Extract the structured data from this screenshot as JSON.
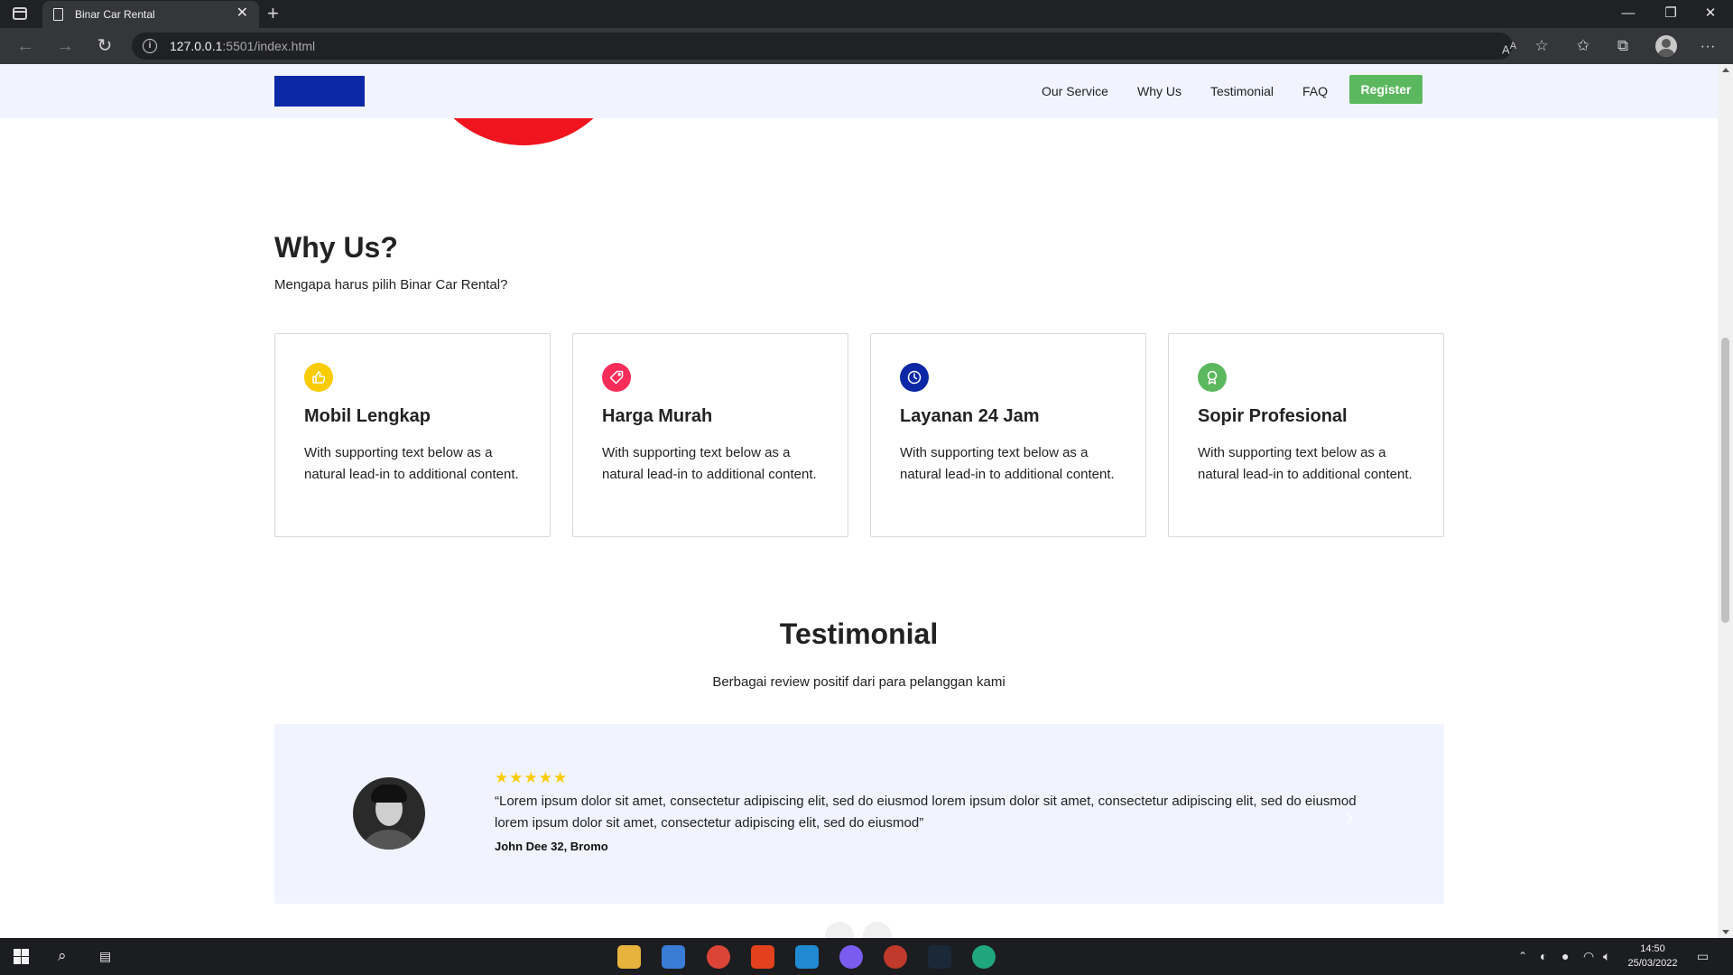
{
  "browser": {
    "tab_title": "Binar Car Rental",
    "tab_close": "✕",
    "new_tab": "+",
    "url_host": "127.0.0.1",
    "url_rest": ":5501/index.html",
    "window_minimize": "—",
    "window_restore": "❐",
    "window_close": "✕"
  },
  "navbar": {
    "links": [
      "Our Service",
      "Why Us",
      "Testimonial",
      "FAQ"
    ],
    "register_label": "Register",
    "logo_color": "#0d28a6"
  },
  "why_us": {
    "title": "Why Us?",
    "subtitle": "Mengapa harus pilih Binar Car Rental?",
    "cards": [
      {
        "title": "Mobil Lengkap",
        "text": "With supporting text below as a natural lead-in to additional content.",
        "icon": "thumbs-up-icon",
        "color": "#f9cc00"
      },
      {
        "title": "Harga Murah",
        "text": "With supporting text below as a natural lead-in to additional content.",
        "icon": "price-tag-icon",
        "color": "#fa2c5a"
      },
      {
        "title": "Layanan 24 Jam",
        "text": "With supporting text below as a natural lead-in to additional content.",
        "icon": "clock-icon",
        "color": "#0d28a6"
      },
      {
        "title": "Sopir Profesional",
        "text": "With supporting text below as a natural lead-in to additional content.",
        "icon": "award-icon",
        "color": "#5cb85f"
      }
    ]
  },
  "testimonial": {
    "title": "Testimonial",
    "subtitle": "Berbagai review positif dari para pelanggan kami",
    "stars": "★★★★★",
    "rating": 5,
    "quote": "“Lorem ipsum dolor sit amet, consectetur adipiscing elit, sed do eiusmod lorem ipsum dolor sit amet, consectetur adipiscing elit, sed do eiusmod lorem ipsum dolor sit amet, consectetur adipiscing elit, sed do eiusmod”",
    "author": "John Dee 32, Bromo",
    "next_glyph": "›"
  },
  "taskbar": {
    "time": "14:50",
    "date": "25/03/2022"
  }
}
